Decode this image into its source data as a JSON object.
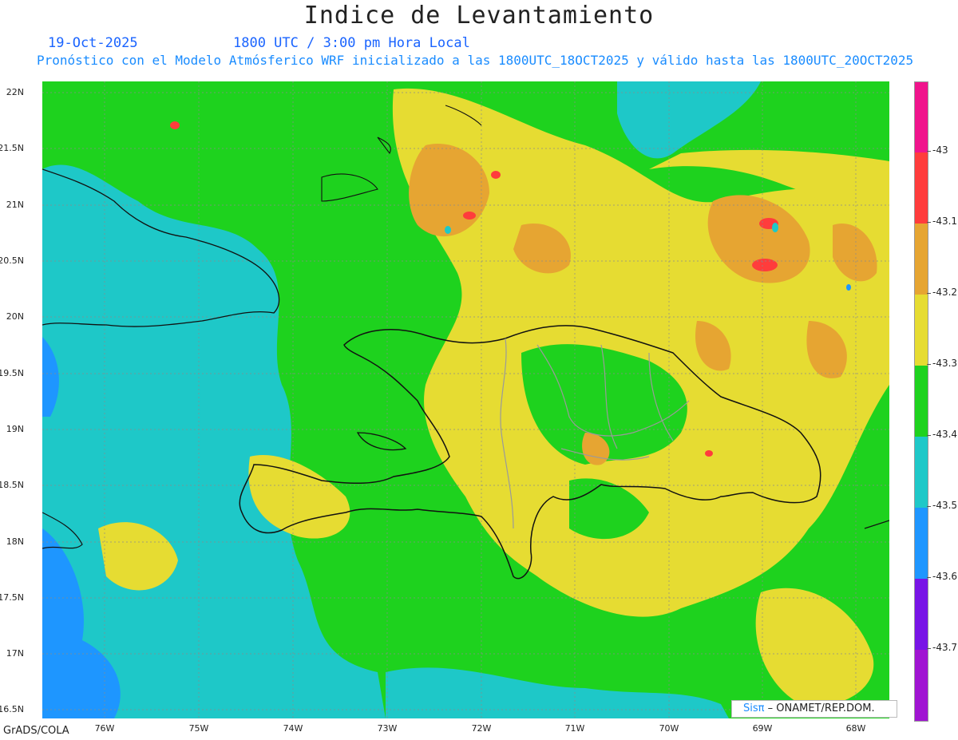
{
  "title": "Indice de Levantamiento",
  "date": "19-Oct-2025",
  "time": "1800 UTC / 3:00 pm Hora Local",
  "subtitle": "Pronóstico con el Modelo Atmósferico WRF inicializado a las 1800UTC_18OCT2025 y válido hasta las  1800UTC_20OCT2025",
  "lat_labels": [
    "22N",
    "21.5N",
    "21N",
    "20.5N",
    "20N",
    "19.5N",
    "19N",
    "18.5N",
    "18N",
    "17.5N",
    "17N",
    "16.5N"
  ],
  "lon_labels": [
    "76W",
    "75W",
    "74W",
    "73W",
    "72W",
    "71W",
    "70W",
    "69W",
    "68W"
  ],
  "colorbar": {
    "labels": [
      "-43",
      "-43.1",
      "-43.2",
      "-43.3",
      "-43.4",
      "-43.5",
      "-43.6",
      "-43.7"
    ],
    "colors": [
      "#f0148c",
      "#ff3c3c",
      "#e6a532",
      "#e6dc32",
      "#1ed21e",
      "#1ec8c8",
      "#1e96ff",
      "#7814e6",
      "#a014d2"
    ]
  },
  "credit": {
    "brand": "Sisπ",
    "text": "ONAMET/REP.DOM."
  },
  "footer": "GrADS/COLA"
}
